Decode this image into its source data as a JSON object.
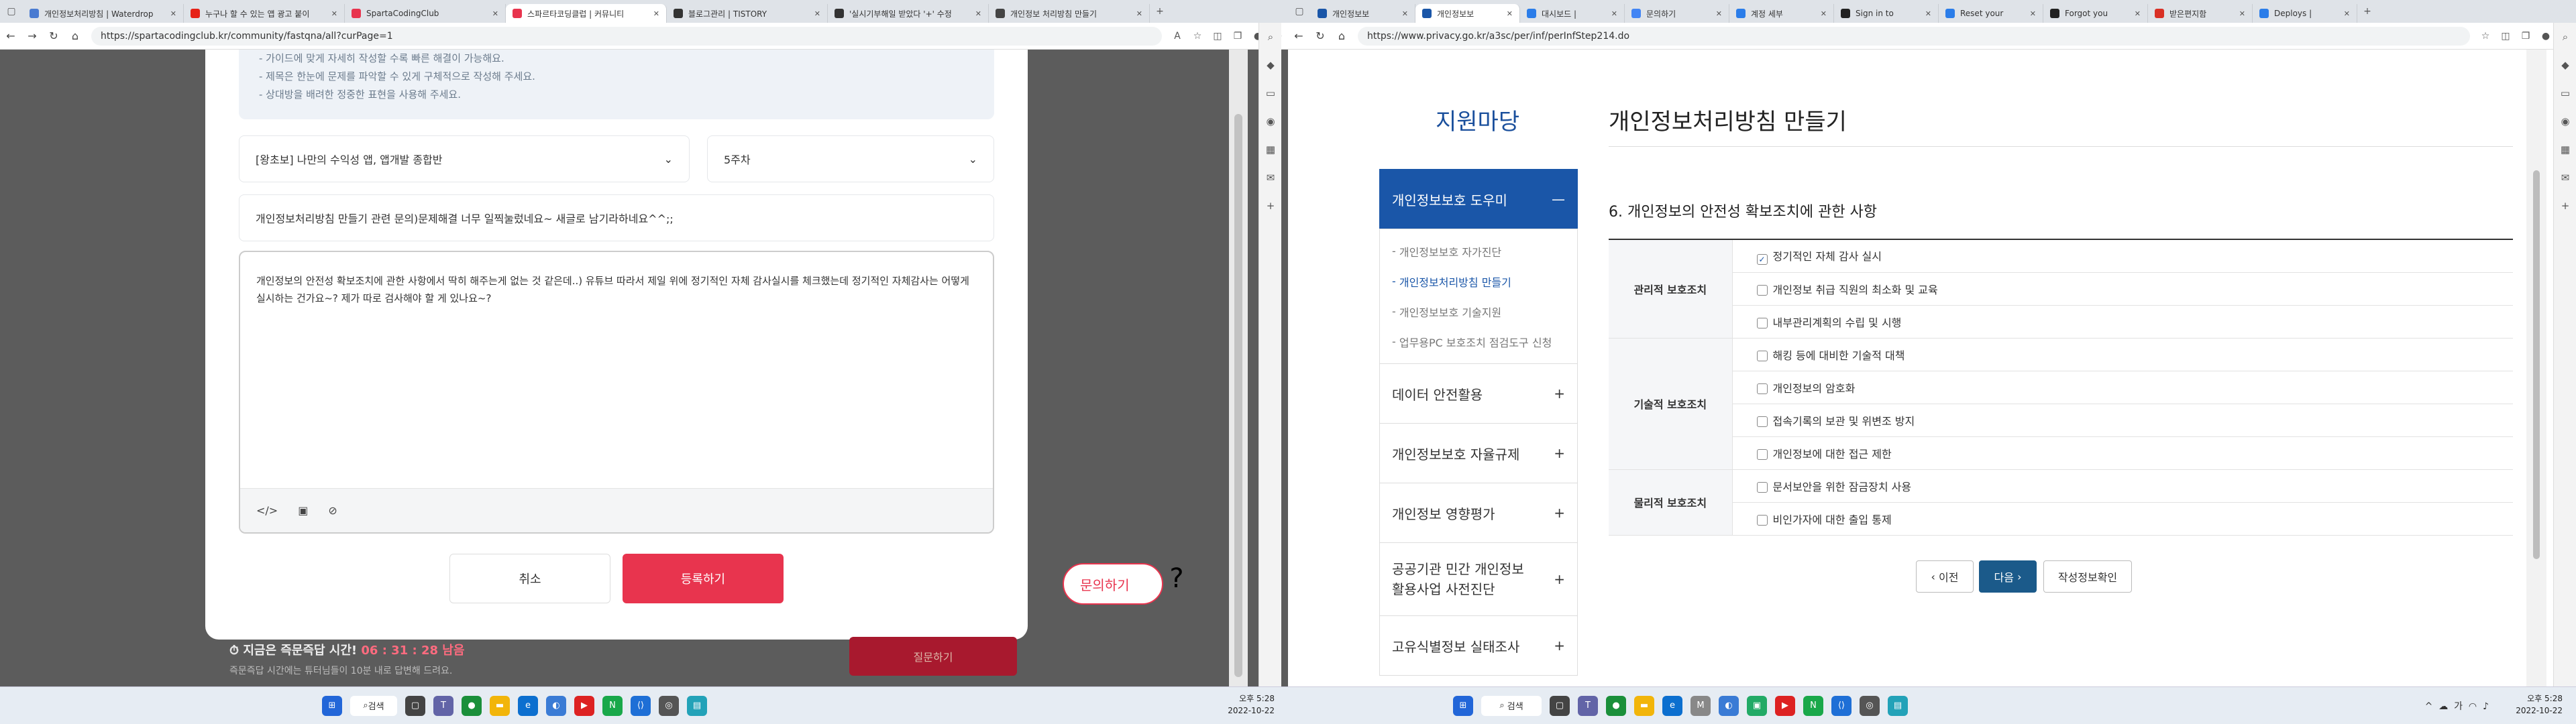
{
  "left": {
    "tabs": [
      {
        "label": "개인정보처리방침 | Waterdrop",
        "color": "#4a7bd1",
        "active": false
      },
      {
        "label": "누구나 할 수 있는 앱 광고 붙이",
        "color": "#e62117",
        "active": false
      },
      {
        "label": "SpartaCodingClub",
        "color": "#e8344e",
        "active": false
      },
      {
        "label": "스파르타코딩클럽 | 커뮤니티",
        "color": "#e8344e",
        "active": true
      },
      {
        "label": "블로그관리 | TISTORY",
        "color": "#333333",
        "active": false
      },
      {
        "label": "'실시기부해일 받았다 '+' 수정",
        "color": "#333333",
        "active": false
      },
      {
        "label": "개인정보 처리방침 만들기",
        "color": "#444444",
        "active": false
      }
    ],
    "url": "https://spartacodingclub.kr/community/fastqna/all?curPage=1",
    "guide_lines": [
      "- 가이드에 맞게 자세히 작성할 수록 빠른 해결이 가능해요.",
      "- 제목은 한눈에 문제를 파악할 수 있게 구체적으로 작성해 주세요.",
      "- 상대방을 배려한 정중한 표현을 사용해 주세요."
    ],
    "course_select": "[왕초보] 나만의 수익성 앱, 앱개발 종합반",
    "week_select": "5주차",
    "title_value": "개인정보처리방침 만들기 관련 문의)문제해결 너무 일찍눌렀네요~ 새글로 남기라하네요^^;;",
    "body_text": "개인정보의 안전성 확보조치에 관한 사항에서 딱히 해주는게 없는 것 같은데..) 유튜브 따라서 제일 위에 정기적인 자체 감사실시를 체크했는데 정기적인 자체감사는 어떻게 실시하는 건가요~? 제가 따로 검사해야 할 게 있나요~?",
    "cancel_label": "취소",
    "submit_label": "등록하기",
    "ask_label": "문의하기",
    "timer_label": "지금은 즉문즉답 시간!",
    "timer_value": "06 : 31 : 28 남음",
    "timer_note": "즉문즉답 시간에는 튜터님들이 10분 내로 답변해 드려요.",
    "ask_bg_label": "질문하기",
    "clock_time": "오후 5:28",
    "clock_date": "2022-10-22"
  },
  "right": {
    "tabs": [
      {
        "label": "개인정보보",
        "color": "#1a56a8",
        "active": false
      },
      {
        "label": "개인정보보",
        "color": "#1a56a8",
        "active": true
      },
      {
        "label": "대시보드 |",
        "color": "#2b7de9",
        "active": false
      },
      {
        "label": "문의하기",
        "color": "#4285f4",
        "active": false
      },
      {
        "label": "계정 세부",
        "color": "#2b7de9",
        "active": false
      },
      {
        "label": "Sign in to",
        "color": "#222222",
        "active": false
      },
      {
        "label": "Reset your",
        "color": "#2b7de9",
        "active": false
      },
      {
        "label": "Forgot you",
        "color": "#222222",
        "active": false
      },
      {
        "label": "받은편지함",
        "color": "#d93025",
        "active": false
      },
      {
        "label": "Deploys |",
        "color": "#2b7de9",
        "active": false
      }
    ],
    "url": "https://www.privacy.go.kr/a3sc/per/inf/perInfStep214.do",
    "lnb_title": "지원마당",
    "page_title": "개인정보처리방침 만들기",
    "lnb_active": "개인정보보호 도우미",
    "lnb_sub": [
      "개인정보보호 자가진단",
      "개인정보처리방침 만들기",
      "개인정보보호 기술지원",
      "업무용PC 보호조치 점검도구 신청"
    ],
    "lnb_items": [
      "데이터 안전활용",
      "개인정보보호 자율규제",
      "개인정보 영향평가",
      "공공기관 민간 개인정보 활용사업 사전진단",
      "고유식별정보 실태조사"
    ],
    "section_title": "6. 개인정보의 안전성 확보조치에 관한 사항",
    "groups": [
      {
        "name": "관리적 보호조치",
        "options": [
          {
            "label": "정기적인 자체 감사 실시",
            "checked": true
          },
          {
            "label": "개인정보 취급 직원의 최소화 및 교육",
            "checked": false
          },
          {
            "label": "내부관리계획의 수립 및 시행",
            "checked": false
          }
        ]
      },
      {
        "name": "기술적 보호조치",
        "options": [
          {
            "label": "해킹 등에 대비한 기술적 대책",
            "checked": false
          },
          {
            "label": "개인정보의 암호화",
            "checked": false
          },
          {
            "label": "접속기록의 보관 및 위변조 방지",
            "checked": false
          },
          {
            "label": "개인정보에 대한 접근 제한",
            "checked": false
          }
        ]
      },
      {
        "name": "물리적 보호조치",
        "options": [
          {
            "label": "문서보안을 위한 잠금장치 사용",
            "checked": false
          },
          {
            "label": "비인가자에 대한 출입 통제",
            "checked": false
          }
        ]
      }
    ],
    "prev_label": "이전",
    "next_label": "다음",
    "confirm_label": "작성정보확인",
    "search_label": "검색",
    "clock_time": "오후 5:28",
    "clock_date": "2022-10-22"
  }
}
